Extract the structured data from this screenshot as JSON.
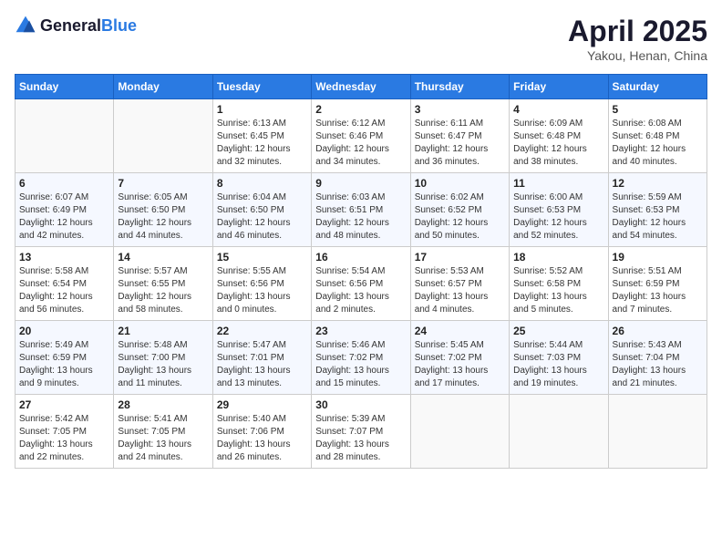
{
  "logo": {
    "text_general": "General",
    "text_blue": "Blue"
  },
  "title": {
    "month": "April 2025",
    "location": "Yakou, Henan, China"
  },
  "calendar": {
    "headers": [
      "Sunday",
      "Monday",
      "Tuesday",
      "Wednesday",
      "Thursday",
      "Friday",
      "Saturday"
    ],
    "rows": [
      [
        {
          "day": "",
          "info": ""
        },
        {
          "day": "",
          "info": ""
        },
        {
          "day": "1",
          "info": "Sunrise: 6:13 AM\nSunset: 6:45 PM\nDaylight: 12 hours\nand 32 minutes."
        },
        {
          "day": "2",
          "info": "Sunrise: 6:12 AM\nSunset: 6:46 PM\nDaylight: 12 hours\nand 34 minutes."
        },
        {
          "day": "3",
          "info": "Sunrise: 6:11 AM\nSunset: 6:47 PM\nDaylight: 12 hours\nand 36 minutes."
        },
        {
          "day": "4",
          "info": "Sunrise: 6:09 AM\nSunset: 6:48 PM\nDaylight: 12 hours\nand 38 minutes."
        },
        {
          "day": "5",
          "info": "Sunrise: 6:08 AM\nSunset: 6:48 PM\nDaylight: 12 hours\nand 40 minutes."
        }
      ],
      [
        {
          "day": "6",
          "info": "Sunrise: 6:07 AM\nSunset: 6:49 PM\nDaylight: 12 hours\nand 42 minutes."
        },
        {
          "day": "7",
          "info": "Sunrise: 6:05 AM\nSunset: 6:50 PM\nDaylight: 12 hours\nand 44 minutes."
        },
        {
          "day": "8",
          "info": "Sunrise: 6:04 AM\nSunset: 6:50 PM\nDaylight: 12 hours\nand 46 minutes."
        },
        {
          "day": "9",
          "info": "Sunrise: 6:03 AM\nSunset: 6:51 PM\nDaylight: 12 hours\nand 48 minutes."
        },
        {
          "day": "10",
          "info": "Sunrise: 6:02 AM\nSunset: 6:52 PM\nDaylight: 12 hours\nand 50 minutes."
        },
        {
          "day": "11",
          "info": "Sunrise: 6:00 AM\nSunset: 6:53 PM\nDaylight: 12 hours\nand 52 minutes."
        },
        {
          "day": "12",
          "info": "Sunrise: 5:59 AM\nSunset: 6:53 PM\nDaylight: 12 hours\nand 54 minutes."
        }
      ],
      [
        {
          "day": "13",
          "info": "Sunrise: 5:58 AM\nSunset: 6:54 PM\nDaylight: 12 hours\nand 56 minutes."
        },
        {
          "day": "14",
          "info": "Sunrise: 5:57 AM\nSunset: 6:55 PM\nDaylight: 12 hours\nand 58 minutes."
        },
        {
          "day": "15",
          "info": "Sunrise: 5:55 AM\nSunset: 6:56 PM\nDaylight: 13 hours\nand 0 minutes."
        },
        {
          "day": "16",
          "info": "Sunrise: 5:54 AM\nSunset: 6:56 PM\nDaylight: 13 hours\nand 2 minutes."
        },
        {
          "day": "17",
          "info": "Sunrise: 5:53 AM\nSunset: 6:57 PM\nDaylight: 13 hours\nand 4 minutes."
        },
        {
          "day": "18",
          "info": "Sunrise: 5:52 AM\nSunset: 6:58 PM\nDaylight: 13 hours\nand 5 minutes."
        },
        {
          "day": "19",
          "info": "Sunrise: 5:51 AM\nSunset: 6:59 PM\nDaylight: 13 hours\nand 7 minutes."
        }
      ],
      [
        {
          "day": "20",
          "info": "Sunrise: 5:49 AM\nSunset: 6:59 PM\nDaylight: 13 hours\nand 9 minutes."
        },
        {
          "day": "21",
          "info": "Sunrise: 5:48 AM\nSunset: 7:00 PM\nDaylight: 13 hours\nand 11 minutes."
        },
        {
          "day": "22",
          "info": "Sunrise: 5:47 AM\nSunset: 7:01 PM\nDaylight: 13 hours\nand 13 minutes."
        },
        {
          "day": "23",
          "info": "Sunrise: 5:46 AM\nSunset: 7:02 PM\nDaylight: 13 hours\nand 15 minutes."
        },
        {
          "day": "24",
          "info": "Sunrise: 5:45 AM\nSunset: 7:02 PM\nDaylight: 13 hours\nand 17 minutes."
        },
        {
          "day": "25",
          "info": "Sunrise: 5:44 AM\nSunset: 7:03 PM\nDaylight: 13 hours\nand 19 minutes."
        },
        {
          "day": "26",
          "info": "Sunrise: 5:43 AM\nSunset: 7:04 PM\nDaylight: 13 hours\nand 21 minutes."
        }
      ],
      [
        {
          "day": "27",
          "info": "Sunrise: 5:42 AM\nSunset: 7:05 PM\nDaylight: 13 hours\nand 22 minutes."
        },
        {
          "day": "28",
          "info": "Sunrise: 5:41 AM\nSunset: 7:05 PM\nDaylight: 13 hours\nand 24 minutes."
        },
        {
          "day": "29",
          "info": "Sunrise: 5:40 AM\nSunset: 7:06 PM\nDaylight: 13 hours\nand 26 minutes."
        },
        {
          "day": "30",
          "info": "Sunrise: 5:39 AM\nSunset: 7:07 PM\nDaylight: 13 hours\nand 28 minutes."
        },
        {
          "day": "",
          "info": ""
        },
        {
          "day": "",
          "info": ""
        },
        {
          "day": "",
          "info": ""
        }
      ]
    ]
  }
}
